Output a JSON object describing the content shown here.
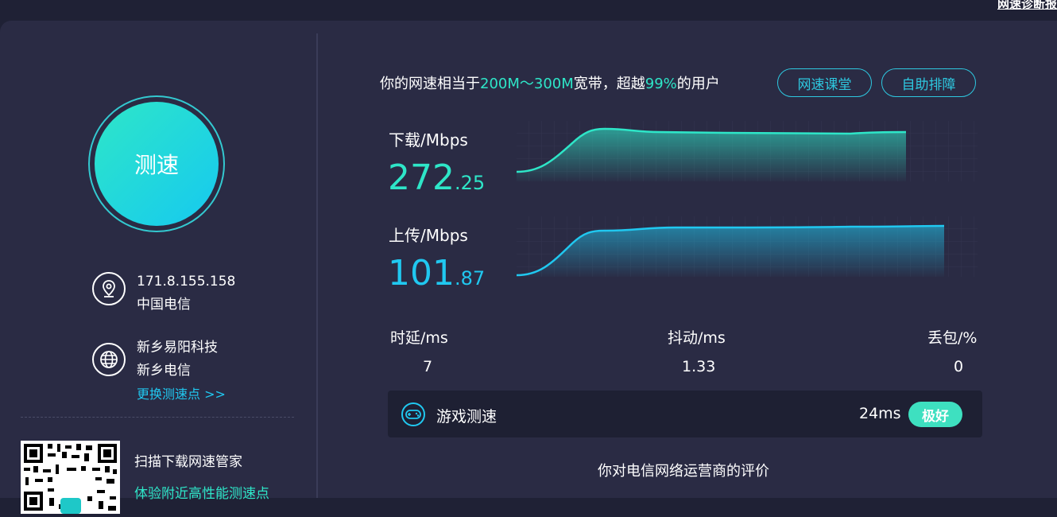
{
  "top_link": "网速诊断报",
  "speed_button": "测速",
  "network": {
    "ip": "171.8.155.158",
    "isp": "中国电信"
  },
  "server": {
    "name": "新乡易阳科技",
    "isp": "新乡电信",
    "change_link": "更换测速点 >>"
  },
  "promo": {
    "line1": "扫描下载网速管家",
    "line2": "体验附近高性能测速点"
  },
  "summary": {
    "prefix": "你的网速相当于",
    "bandwidth": "200M～300M",
    "middle": "宽带，超越",
    "percent": "99%",
    "suffix": "的用户"
  },
  "buttons": {
    "course": "网速课堂",
    "troubleshoot": "自助排障"
  },
  "download": {
    "label": "下载/Mbps",
    "int": "272",
    "dec": ".25",
    "color": "#2ee6c8"
  },
  "upload": {
    "label": "上传/Mbps",
    "int": "101",
    "dec": ".87",
    "color": "#20c8f0"
  },
  "stats": {
    "latency": {
      "label": "时延/ms",
      "value": "7"
    },
    "jitter": {
      "label": "抖动/ms",
      "value": "1.33"
    },
    "loss": {
      "label": "丢包/%",
      "value": "0"
    }
  },
  "game": {
    "label": "游戏测速",
    "ms": "24ms",
    "rating": "极好"
  },
  "evaluation_title": "你对电信网络运营商的评价",
  "colors": {
    "accent_green": "#2ee6c8",
    "accent_blue": "#20c8f0",
    "panel": "#2a2b44",
    "background": "#1f2135"
  },
  "icons": [
    "location-icon",
    "globe-icon",
    "gamepad-icon",
    "qr-code"
  ]
}
